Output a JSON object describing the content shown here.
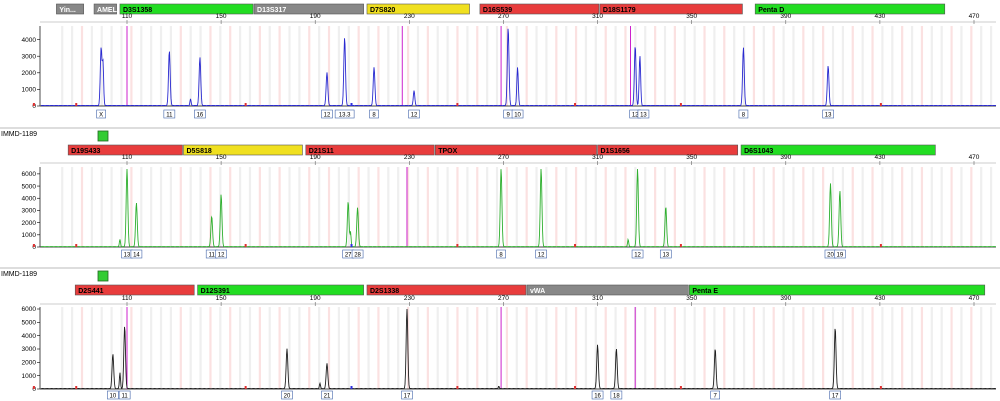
{
  "panels": [
    {
      "sample_label": "",
      "color": "#2a2ad0",
      "scale_ticks": [
        110,
        150,
        190,
        230,
        270,
        310,
        350,
        390,
        430,
        470
      ],
      "y_ticks": [
        0,
        1000,
        2000,
        3000,
        4000
      ],
      "y_max": 4700,
      "markers": [
        {
          "name": "Yin...",
          "color": "#888888",
          "start": 80,
          "end": 92
        },
        {
          "name": "AMEL",
          "color": "#888888",
          "start": 96,
          "end": 106
        },
        {
          "name": "D3S1358",
          "color": "#22dd22",
          "start": 107,
          "end": 164
        },
        {
          "name": "D13S317",
          "color": "#888888",
          "start": 164,
          "end": 211
        },
        {
          "name": "D7S820",
          "color": "#f0e020",
          "start": 212,
          "end": 256
        },
        {
          "name": "D16S539",
          "color": "#e83c3c",
          "start": 260,
          "end": 311
        },
        {
          "name": "D18S1179",
          "color": "#e83c3c",
          "start": 311,
          "end": 372
        },
        {
          "name": "Penta D",
          "color": "#22dd22",
          "start": 377,
          "end": 458
        }
      ],
      "peaks": [
        {
          "x": 99,
          "h": 3500,
          "w": 0.9
        },
        {
          "x": 99.8,
          "h": 2500,
          "w": 0.7
        },
        {
          "x": 128,
          "h": 3300,
          "w": 0.9
        },
        {
          "x": 141,
          "h": 2900,
          "w": 0.9
        },
        {
          "x": 137,
          "h": 400,
          "w": 0.6
        },
        {
          "x": 195,
          "h": 2000,
          "w": 0.9
        },
        {
          "x": 202.5,
          "h": 4100,
          "w": 0.9
        },
        {
          "x": 215,
          "h": 2300,
          "w": 0.9
        },
        {
          "x": 232,
          "h": 900,
          "w": 0.8
        },
        {
          "x": 272,
          "h": 4700,
          "w": 0.9
        },
        {
          "x": 276,
          "h": 2300,
          "w": 0.8
        },
        {
          "x": 326,
          "h": 3600,
          "w": 0.9
        },
        {
          "x": 328,
          "h": 3000,
          "w": 0.8
        },
        {
          "x": 372,
          "h": 3500,
          "w": 0.9
        },
        {
          "x": 408,
          "h": 2400,
          "w": 0.9
        }
      ],
      "allele_labels": [
        {
          "x": 99,
          "text": "X"
        },
        {
          "x": 128,
          "text": "11"
        },
        {
          "x": 141,
          "text": "16"
        },
        {
          "x": 195,
          "text": "12"
        },
        {
          "x": 202.5,
          "text": "13.3"
        },
        {
          "x": 215,
          "text": "8"
        },
        {
          "x": 232,
          "text": "12"
        },
        {
          "x": 272,
          "text": "9"
        },
        {
          "x": 276,
          "text": "10"
        },
        {
          "x": 326,
          "text": "12"
        },
        {
          "x": 329.5,
          "text": "13"
        },
        {
          "x": 372,
          "text": "8"
        },
        {
          "x": 408,
          "text": "13"
        }
      ],
      "magenta_lines": [
        110,
        227,
        269,
        324
      ]
    },
    {
      "sample_label": "IMMD-1189",
      "color": "#30b030",
      "scale_ticks": [
        110,
        150,
        190,
        230,
        270,
        310,
        350,
        390,
        430,
        470
      ],
      "y_ticks": [
        0,
        1000,
        2000,
        3000,
        4000,
        5000,
        6000
      ],
      "y_max": 6400,
      "markers": [
        {
          "name": "D19S433",
          "color": "#e83c3c",
          "start": 85,
          "end": 134
        },
        {
          "name": "D5S818",
          "color": "#f0e020",
          "start": 134,
          "end": 185
        },
        {
          "name": "D21S11",
          "color": "#e83c3c",
          "start": 186,
          "end": 241
        },
        {
          "name": "TPOX",
          "color": "#e83c3c",
          "start": 241,
          "end": 310
        },
        {
          "name": "D1S1656",
          "color": "#e83c3c",
          "start": 310,
          "end": 370
        },
        {
          "name": "D6S1043",
          "color": "#22dd22",
          "start": 371,
          "end": 454
        }
      ],
      "peaks": [
        {
          "x": 110,
          "h": 6400,
          "w": 0.9
        },
        {
          "x": 114,
          "h": 3600,
          "w": 0.9
        },
        {
          "x": 107,
          "h": 600,
          "w": 0.6
        },
        {
          "x": 146,
          "h": 2500,
          "w": 0.9
        },
        {
          "x": 150,
          "h": 4300,
          "w": 0.9
        },
        {
          "x": 204,
          "h": 3700,
          "w": 0.9
        },
        {
          "x": 208,
          "h": 3200,
          "w": 0.9
        },
        {
          "x": 205,
          "h": 1200,
          "w": 0.6
        },
        {
          "x": 269,
          "h": 6400,
          "w": 0.9
        },
        {
          "x": 286,
          "h": 6400,
          "w": 0.9
        },
        {
          "x": 327,
          "h": 6400,
          "w": 0.9
        },
        {
          "x": 339,
          "h": 3300,
          "w": 0.9
        },
        {
          "x": 323,
          "h": 600,
          "w": 0.6
        },
        {
          "x": 409,
          "h": 5200,
          "w": 0.9
        },
        {
          "x": 413,
          "h": 4600,
          "w": 0.9
        }
      ],
      "allele_labels": [
        {
          "x": 110,
          "text": "13"
        },
        {
          "x": 114,
          "text": "14"
        },
        {
          "x": 146,
          "text": "11"
        },
        {
          "x": 150,
          "text": "12"
        },
        {
          "x": 204,
          "text": "27"
        },
        {
          "x": 208,
          "text": "28"
        },
        {
          "x": 269,
          "text": "8"
        },
        {
          "x": 286,
          "text": "12"
        },
        {
          "x": 327,
          "text": "12"
        },
        {
          "x": 339,
          "text": "13"
        },
        {
          "x": 409,
          "text": "20"
        },
        {
          "x": 413,
          "text": "19"
        }
      ],
      "magenta_lines": [
        229
      ]
    },
    {
      "sample_label": "IMMD-1189",
      "color": "#202020",
      "scale_ticks": [
        110,
        150,
        190,
        230,
        270,
        310,
        350,
        390,
        430,
        470
      ],
      "y_ticks": [
        0,
        1000,
        2000,
        3000,
        4000,
        5000,
        6000
      ],
      "y_max": 6000,
      "markers": [
        {
          "name": "D2S441",
          "color": "#e83c3c",
          "start": 88,
          "end": 139
        },
        {
          "name": "D12S391",
          "color": "#22dd22",
          "start": 140,
          "end": 211
        },
        {
          "name": "D2S1338",
          "color": "#e83c3c",
          "start": 212,
          "end": 280
        },
        {
          "name": "vWA",
          "color": "#888888",
          "start": 280,
          "end": 349
        },
        {
          "name": "Penta E",
          "color": "#22dd22",
          "start": 349,
          "end": 475
        }
      ],
      "peaks": [
        {
          "x": 104,
          "h": 2600,
          "w": 0.9
        },
        {
          "x": 109,
          "h": 4700,
          "w": 0.9
        },
        {
          "x": 107,
          "h": 1200,
          "w": 0.6
        },
        {
          "x": 178,
          "h": 3000,
          "w": 0.9
        },
        {
          "x": 195,
          "h": 1900,
          "w": 0.9
        },
        {
          "x": 192,
          "h": 400,
          "w": 0.6
        },
        {
          "x": 229,
          "h": 6000,
          "w": 0.9
        },
        {
          "x": 310,
          "h": 3300,
          "w": 0.9
        },
        {
          "x": 318,
          "h": 3000,
          "w": 0.9
        },
        {
          "x": 360,
          "h": 3000,
          "w": 0.9
        },
        {
          "x": 411,
          "h": 4600,
          "w": 0.9
        },
        {
          "x": 268,
          "h": 200,
          "w": 0.5
        }
      ],
      "allele_labels": [
        {
          "x": 104,
          "text": "10"
        },
        {
          "x": 109,
          "text": "11"
        },
        {
          "x": 178,
          "text": "20"
        },
        {
          "x": 195,
          "text": "21"
        },
        {
          "x": 229,
          "text": "17"
        },
        {
          "x": 310,
          "text": "16"
        },
        {
          "x": 318,
          "text": "18"
        },
        {
          "x": 360,
          "text": "7"
        },
        {
          "x": 411,
          "text": "17"
        }
      ],
      "magenta_lines": [
        110,
        269,
        326
      ]
    }
  ]
}
